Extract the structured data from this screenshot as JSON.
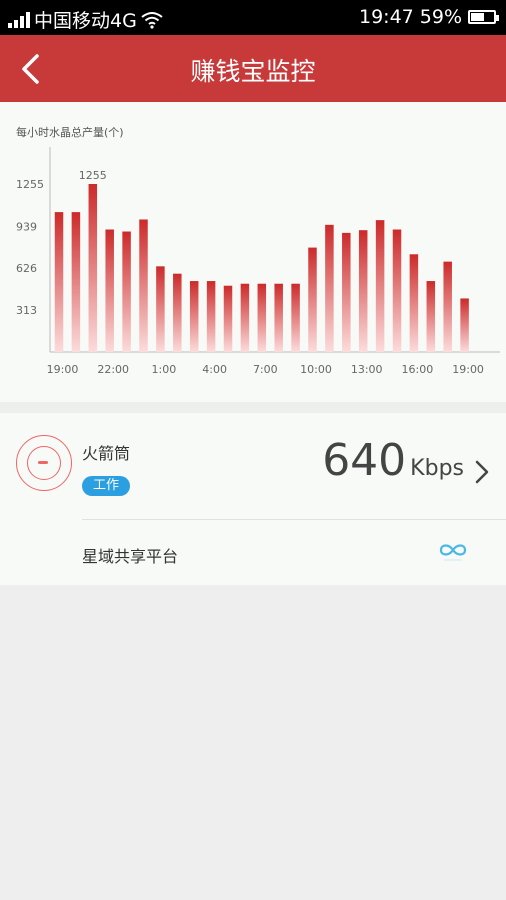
{
  "status_bar": {
    "carrier": "中国移动4G",
    "time": "19:47",
    "battery": "59%",
    "battery_level": 0.59
  },
  "header": {
    "title": "赚钱宝监控",
    "icons": {
      "back": "back-arrow-icon"
    }
  },
  "chart": {
    "caption": "每小时水晶总产量(个)"
  },
  "chart_data": {
    "type": "bar",
    "title": "每小时水晶总产量(个)",
    "y_ticks": [
      313,
      626,
      939,
      1255
    ],
    "ylim": [
      0,
      1400
    ],
    "x_ticks": [
      "19:00",
      "22:00",
      "1:00",
      "4:00",
      "7:00",
      "10:00",
      "13:00",
      "16:00",
      "19:00"
    ],
    "values": [
      1045,
      1045,
      1255,
      915,
      900,
      990,
      640,
      585,
      530,
      530,
      495,
      510,
      510,
      510,
      510,
      780,
      950,
      890,
      910,
      985,
      915,
      730,
      530,
      675,
      400
    ],
    "annotation": {
      "index": 2,
      "label": "1255"
    },
    "grid": false,
    "colors": {
      "bar_top": "#cc2a2a",
      "bar_bottom": "#fcdcdc"
    }
  },
  "device": {
    "name": "火箭筒",
    "status": "工作",
    "speed_value": "640",
    "speed_unit": "Kbps",
    "platform_label": "星域共享平台",
    "icons": {
      "avatar": "router-icon",
      "chevron": "chevron-right-icon",
      "platform": "infinity-icon"
    },
    "colors": {
      "badge": "#2b9fe0",
      "avatar_ring": "#e66666"
    }
  }
}
